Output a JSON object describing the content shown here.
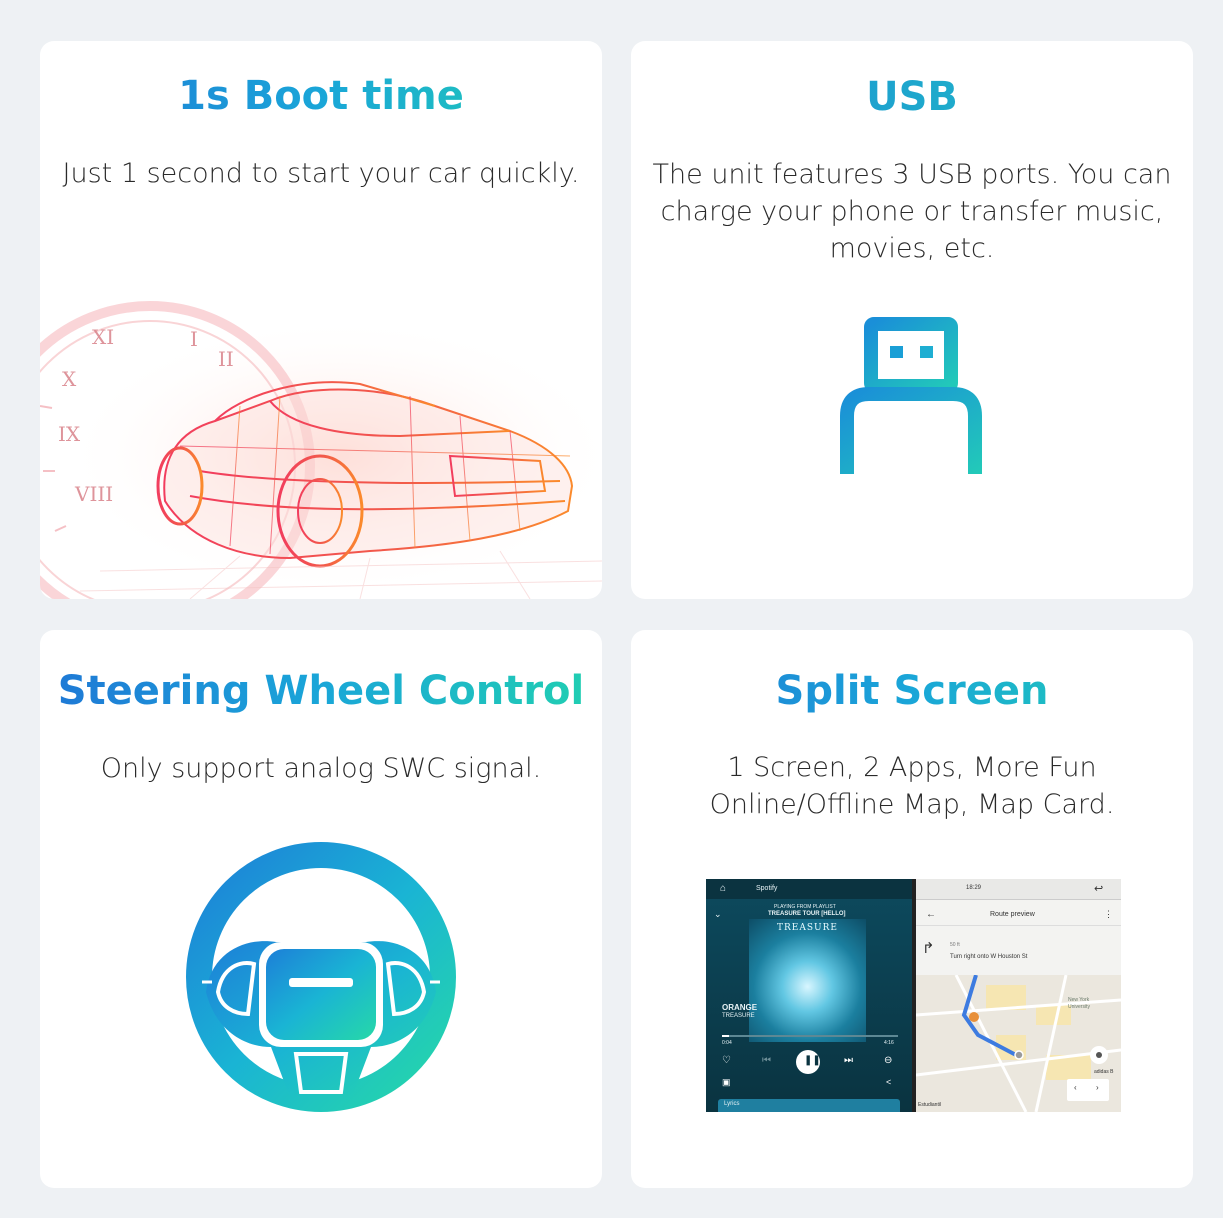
{
  "cards": {
    "boot": {
      "title": "1s Boot time",
      "desc_line1": "Just 1 second to start your car quickly."
    },
    "usb": {
      "title": "USB",
      "desc_line1": "The unit features 3 USB ports. You can",
      "desc_line2": "charge your phone or transfer music,",
      "desc_line3": "movies, etc."
    },
    "swc": {
      "title": "Steering Wheel Control",
      "desc_line1": "Only support analog SWC signal."
    },
    "split": {
      "title": "Split Screen",
      "desc_line1": "1 Screen, 2 Apps, More Fun",
      "desc_line2": "Online/Offline Map, Map Card."
    }
  },
  "phone": {
    "app_name": "Spotify",
    "playing_from": "PLAYING FROM PLAYLIST",
    "playlist": "TREASURE TOUR [HELLO]",
    "album_art_text": "TREASURE",
    "song": "ORANGE",
    "artist": "TREASURE",
    "time_elapsed": "0:04",
    "time_total": "4:16",
    "lyrics_label": "Lyrics",
    "status_time": "18:29",
    "route_title": "Route preview",
    "distance": "50 ft",
    "instruction": "Turn right onto W Houston St",
    "poi_label1": "New York",
    "poi_label2": "University",
    "poi_label3": "adidas B",
    "poi_label4": "Estudiantil"
  },
  "colors": {
    "gradient_start": "#1f77d6",
    "gradient_end": "#21d0b0",
    "background": "#eef1f4",
    "card": "#ffffff"
  },
  "icons": [
    "clock-car-illustration",
    "usb-icon",
    "steering-wheel-icon",
    "split-screen-screenshot"
  ]
}
